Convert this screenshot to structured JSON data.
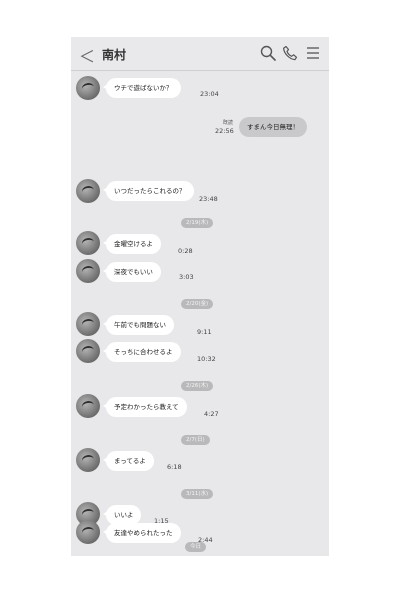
{
  "header": {
    "back_symbol": "＜",
    "title": "南村",
    "icons": [
      "search-icon",
      "phone-icon",
      "menu-icon"
    ]
  },
  "messages": [
    {
      "text": "ウチで遊ばないか？",
      "time": "23:04"
    },
    {
      "text": "すまん今日無理！",
      "time": "22:56",
      "read": "既読"
    },
    {
      "text": "いつだったらこれるの？",
      "time": "23:48"
    },
    {
      "date": "2/19(木)"
    },
    {
      "text": "金曜空けるよ",
      "time": "0:28"
    },
    {
      "text": "深夜でもいい",
      "time": "3:03"
    },
    {
      "date": "2/20(金)"
    },
    {
      "text": "午前でも問題ない",
      "time": "9:11"
    },
    {
      "text": "そっちに合わせるよ",
      "time": "10:32"
    },
    {
      "date": "2/26(木)"
    },
    {
      "text": "予定わかったら教えて",
      "time": "4:27"
    },
    {
      "date": "2/7(日)"
    },
    {
      "text": "まってるよ",
      "time": "6:18"
    },
    {
      "date": "3/11(水)"
    },
    {
      "text": "いいよ",
      "time": "1:15"
    },
    {
      "date": "今日"
    },
    {
      "text": "友達やめられたった",
      "time": "2:44"
    }
  ]
}
